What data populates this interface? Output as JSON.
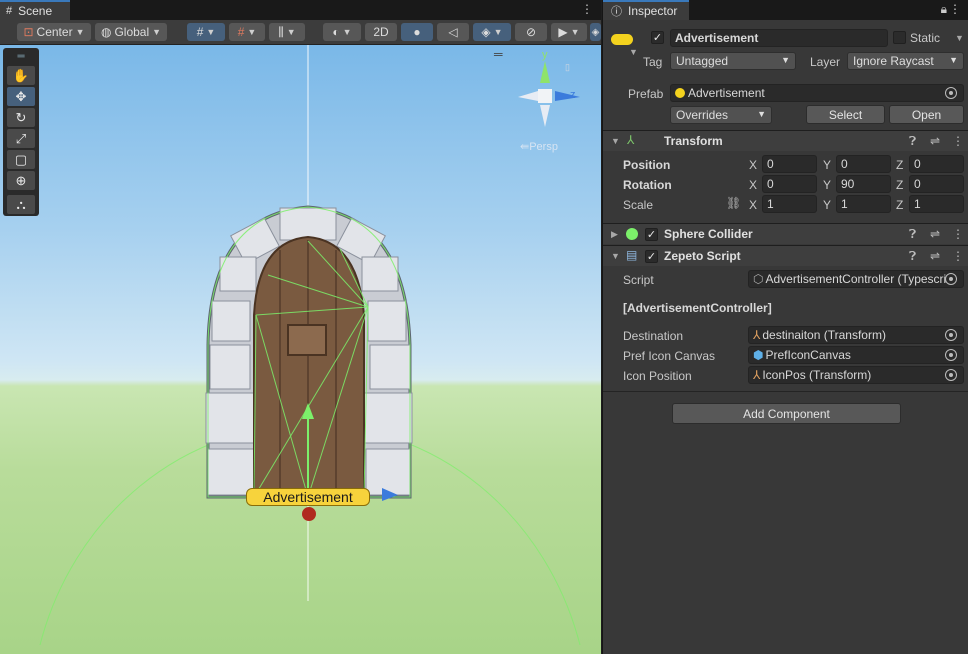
{
  "scene": {
    "tab_label": "Scene",
    "toolbar": {
      "pivot": "Center",
      "space": "Global",
      "mode_2d": "2D"
    },
    "gizmo": {
      "persp_label": "Persp",
      "axis_y": "y",
      "axis_z": "z"
    },
    "selected_object_label": "Advertisement"
  },
  "inspector": {
    "tab_label": "Inspector",
    "object": {
      "name": "Advertisement",
      "static_label": "Static",
      "tag_label": "Tag",
      "tag_value": "Untagged",
      "layer_label": "Layer",
      "layer_value": "Ignore Raycast"
    },
    "prefab": {
      "label": "Prefab",
      "value": "Advertisement",
      "overrides": "Overrides",
      "select": "Select",
      "open": "Open"
    },
    "transform": {
      "title": "Transform",
      "rows": [
        {
          "label": "Position",
          "x": "0",
          "y": "0",
          "z": "0"
        },
        {
          "label": "Rotation",
          "x": "0",
          "y": "90",
          "z": "0"
        },
        {
          "label": "Scale",
          "x": "1",
          "y": "1",
          "z": "1"
        }
      ],
      "axis_x": "X",
      "axis_y": "Y",
      "axis_z": "Z"
    },
    "sphere_collider": {
      "title": "Sphere Collider"
    },
    "zepeto_script": {
      "title": "Zepeto Script",
      "script_label": "Script",
      "script_value": "AdvertisementController (Typescri",
      "section_header": "[AdvertisementController]",
      "fields": [
        {
          "label": "Destination",
          "value": "destinaiton (Transform)"
        },
        {
          "label": "Pref Icon Canvas",
          "value": "PrefIconCanvas"
        },
        {
          "label": "Icon Position",
          "value": "IconPos (Transform)"
        }
      ]
    },
    "add_component": "Add Component"
  },
  "colors": {
    "accent": "#3a79bb",
    "selected_label": "#f7d33c",
    "wire_green": "#7cf06a"
  }
}
